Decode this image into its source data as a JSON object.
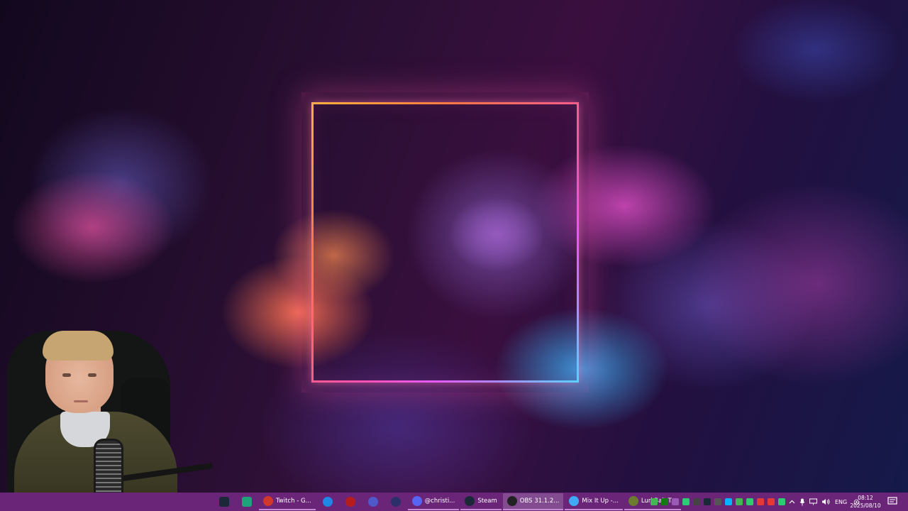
{
  "desktop": {
    "wallpaper": "neon-frame-clouds"
  },
  "taskbar": {
    "pinned_icons": [
      {
        "name": "steam-pinned-icon",
        "color": "#1b2838"
      },
      {
        "name": "green-app-icon",
        "color": "#1fa37a"
      }
    ],
    "apps": [
      {
        "name": "twitch",
        "label": "Twitch - G...",
        "color": "#d0382b",
        "active": false
      },
      {
        "name": "bing",
        "label": "",
        "color": "#1e88e5",
        "active": false
      },
      {
        "name": "red-app",
        "label": "",
        "color": "#b71c1c",
        "active": false
      },
      {
        "name": "teams",
        "label": "",
        "color": "#5059c9",
        "active": false
      },
      {
        "name": "screen-app",
        "label": "",
        "color": "#2d2f6b",
        "active": false
      },
      {
        "name": "discord",
        "label": "@christi...",
        "color": "#5865f2",
        "active": false
      },
      {
        "name": "steam",
        "label": "Steam",
        "color": "#1b2838",
        "active": false
      },
      {
        "name": "obs",
        "label": "OBS 31.1.2...",
        "color": "#222222",
        "active": true
      },
      {
        "name": "mixitup",
        "label": "Mix It Up -...",
        "color": "#3fa9f5",
        "active": false
      },
      {
        "name": "lurkbait",
        "label": "LurkBait T...",
        "color": "#6b7c2e",
        "active": false
      }
    ],
    "tray": {
      "icons": [
        "#3fb950",
        "#107c10",
        "#9b59b6",
        "#2ecc71",
        "#444",
        "#1b2838",
        "#555",
        "#00b4ff",
        "#3fb950",
        "#2ecc71",
        "#e53935",
        "#e53935",
        "#2ecc71"
      ],
      "language": "ENG"
    },
    "clock": {
      "time": "08:12",
      "date": "2025/08/10"
    }
  }
}
